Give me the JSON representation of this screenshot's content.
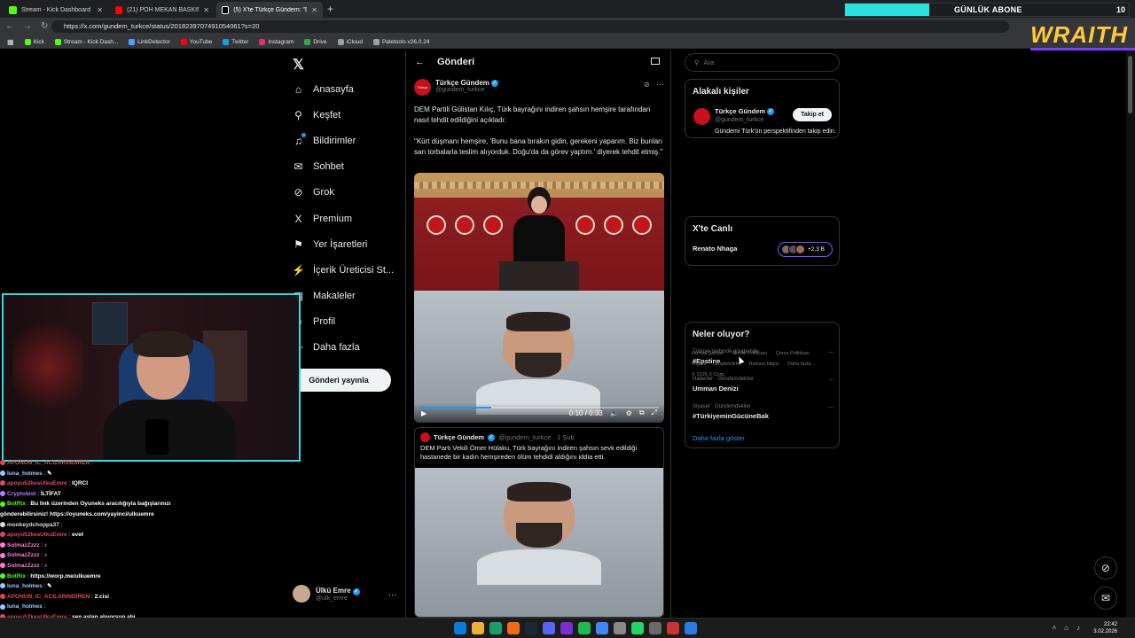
{
  "browser": {
    "tabs": [
      {
        "title": "Stream - Kick Dashboard",
        "color": "#53fc18"
      },
      {
        "title": "(21) POH MEKAN BASKINI #pohhu",
        "color": "#ff0000"
      },
      {
        "title": "(5) X'te Türkçe Gündem: \"DEM Pa",
        "color": "#ffffff"
      }
    ],
    "url": "https://x.com/gundem_turkce/status/2018239707491054061?s=20",
    "bookmarks": [
      {
        "label": "Kick",
        "color": "#53fc18"
      },
      {
        "label": "Stream - Kick Dash...",
        "color": "#53fc18"
      },
      {
        "label": "LinkDetector",
        "color": "#4aa3ff"
      },
      {
        "label": "YouTube",
        "color": "#ff0000"
      },
      {
        "label": "Twitter",
        "color": "#1d9bf0"
      },
      {
        "label": "Instagram",
        "color": "#e1306c"
      },
      {
        "label": "Drive",
        "color": "#34a853"
      },
      {
        "label": "iCloud",
        "color": "#9aa0a6"
      },
      {
        "label": "Paletools v26.0.24",
        "color": "#9aa0a6"
      }
    ]
  },
  "overlay": {
    "abone_label": "GÜNLÜK ABONE",
    "abone_count": "10",
    "brand": "WRAITH"
  },
  "sidebar": {
    "items": [
      {
        "label": "Anasayfa",
        "icon": "home-icon",
        "glyph": "⌂"
      },
      {
        "label": "Keşfet",
        "icon": "search-icon",
        "glyph": "⚲"
      },
      {
        "label": "Bildirimler",
        "icon": "bell-icon",
        "glyph": "♫"
      },
      {
        "label": "Sohbet",
        "icon": "mail-icon",
        "glyph": "✉"
      },
      {
        "label": "Grok",
        "icon": "grok-icon",
        "glyph": "⊘"
      },
      {
        "label": "Premium",
        "icon": "x-icon",
        "glyph": "X"
      },
      {
        "label": "Yer İşaretleri",
        "icon": "bookmark-icon",
        "glyph": "⚑"
      },
      {
        "label": "İçerik Üreticisi St...",
        "icon": "creator-icon",
        "glyph": "⚡"
      },
      {
        "label": "Makaleler",
        "icon": "article-icon",
        "glyph": "▤"
      },
      {
        "label": "Profil",
        "icon": "profile-icon",
        "glyph": "☺"
      },
      {
        "label": "Daha fazla",
        "icon": "more-icon",
        "glyph": "⋯"
      }
    ],
    "post_button": "Gönderi yayınla",
    "account": {
      "name": "Ülkü Emre",
      "handle": "@ulk_emre"
    }
  },
  "main": {
    "header": "Gönderi",
    "tweet": {
      "author": "Türkçe Gündem",
      "handle": "@gundem_turkce",
      "avatar_text": "Türkçe",
      "text1": "DEM Partili Gülistan Kılıç, Türk bayrağını indiren şahsın hemşire tarafından nasıl tehdit edildiğini açıkladı:",
      "text2": "\"Kürt düşmanı hemşire, 'Bunu bana bırakın gidin, gerekeni yaparım. Biz bunları sarı torbalarla teslim alıyorduk. Doğu'da da görev yaptım.' diyerek tehdit etmiş.\"",
      "video_time": "0:10 / 0:33",
      "progress": 0.3
    },
    "quote": {
      "author": "Türkçe Gündem",
      "meta": "@gundem_turkce · 1 Şub",
      "text": "DEM Parti Vekili Ömer Hülaku, Türk bayrağını indiren şahsın sevk edildiği hastanede bir kadın hemşireden ölüm tehdidi aldığını iddia etti."
    }
  },
  "right": {
    "search_placeholder": "Ara",
    "related": {
      "title": "Alakalı kişiler",
      "name": "Türkçe Gündem",
      "handle": "@gundem_turkce",
      "desc": "Gündemi Türk'ün perspektifinden takip edin.",
      "follow": "Takip et"
    },
    "live": {
      "title": "X'te Canlı",
      "name": "Renato Nhaga",
      "count": "+2,3 B"
    },
    "trends": {
      "title": "Neler oluyor?",
      "items": [
        {
          "context": "Türkiye tarihinde gündemde",
          "tag": "#Epstine"
        },
        {
          "context": "Haberler · Gündemdekiler",
          "tag": "Umman Denizi"
        },
        {
          "context": "Siyaset · Gündemdekiler",
          "tag": "#TürkiyeminGücüneBak"
        }
      ],
      "more": "Daha fazla göster"
    },
    "footer": [
      "Hizmet Şartları",
      "Gizlilik Politikası",
      "Çerez Politikası",
      "Imprint",
      "Erişilebilirlik",
      "Reklam bilgisi",
      "Daha fazla ...",
      "© 2026 X Corp."
    ]
  },
  "chat": [
    {
      "user": "APONUN_IC_ACILARINDIREN",
      "text": "",
      "color": "#e04a4a"
    },
    {
      "user": "luna_holmes",
      "text": "✎",
      "color": "#9ec7ff"
    },
    {
      "user": "apoyu52kesUlkuEmre",
      "text": "IQRCI",
      "color": "#d94a6a"
    },
    {
      "user": "Cryptobist",
      "text": "İLTİFAT",
      "color": "#b77cff"
    },
    {
      "user": "BotRix",
      "text": "Bu link üzerinden Oyuneks aracılığıyla bağışlarınızı",
      "color": "#53fc18"
    },
    {
      "user": "",
      "text": "gönderebilirsiniz! https://oyuneks.com/yayinci/ulkuemre",
      "color": "#ffffff"
    },
    {
      "user": "monkeydchoppa37",
      "text": "",
      "color": "#dcdcdc"
    },
    {
      "user": "apoyu52kesUlkuEmre",
      "text": "evet",
      "color": "#d94a6a"
    },
    {
      "user": "SolmazZzzz",
      "text": "♪",
      "color": "#ff7ad9"
    },
    {
      "user": "SolmazZzzz",
      "text": "♪",
      "color": "#ff7ad9"
    },
    {
      "user": "SolmazZzzz",
      "text": "♪",
      "color": "#ff7ad9"
    },
    {
      "user": "BotRix",
      "text": "https://worp.me/ulkuemre",
      "color": "#53fc18"
    },
    {
      "user": "luna_holmes",
      "text": "✎",
      "color": "#9ec7ff"
    },
    {
      "user": "APONUN_IC_ACILARINDIREN",
      "text": "2.cisi",
      "color": "#e04a4a"
    },
    {
      "user": "luna_holmes",
      "text": "",
      "color": "#9ec7ff"
    },
    {
      "user": "apoyu52kesUlkuEmre",
      "text": "sen aslan alıyorsun abi",
      "color": "#d94a6a"
    },
    {
      "user": "monkeydchoppa37",
      "text": "imparator direkt",
      "color": "#dcdcdc"
    }
  ],
  "taskbar": {
    "time": "22:42",
    "date": "3.02.2026"
  },
  "colors": {
    "accent": "#1d9bf0",
    "cam_border": "#2be0e6",
    "abone_bar": "#2de0e0",
    "brand": "#ffc93a"
  }
}
